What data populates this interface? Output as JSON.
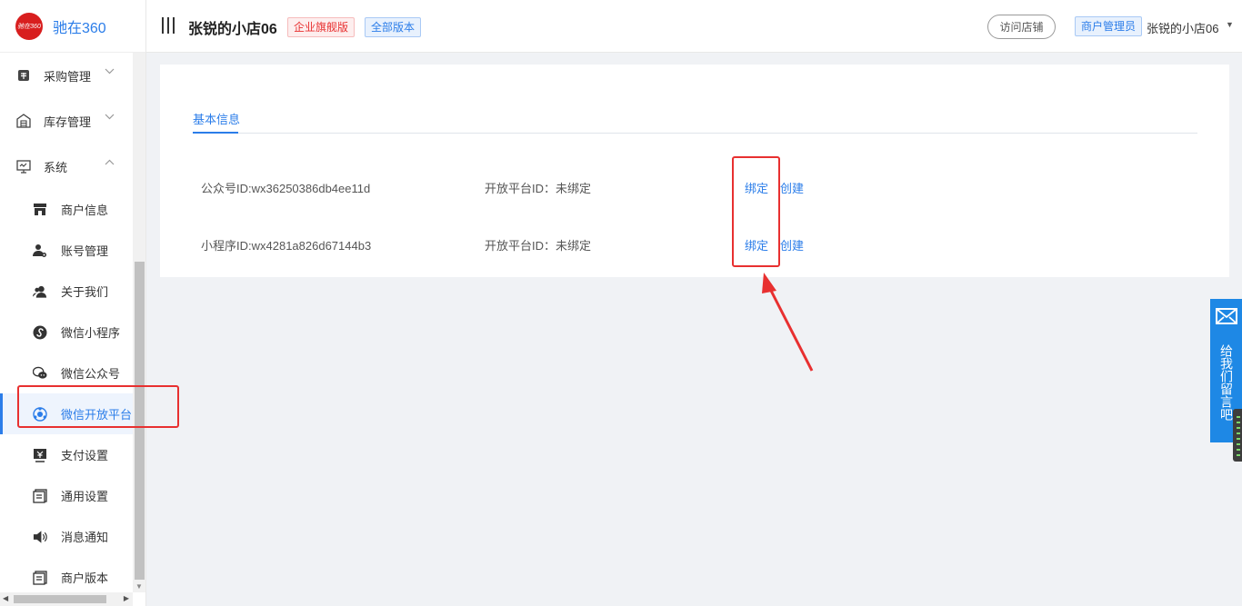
{
  "brand": {
    "name": "驰在360",
    "logo_text": "驰在360"
  },
  "sidebar": {
    "groups": [
      {
        "label": "采购管理",
        "icon": "purchase-icon",
        "expanded": false
      },
      {
        "label": "库存管理",
        "icon": "warehouse-icon",
        "expanded": false
      },
      {
        "label": "系统",
        "icon": "monitor-icon",
        "expanded": true
      }
    ],
    "items": [
      {
        "label": "商户信息",
        "icon": "store-icon"
      },
      {
        "label": "账号管理",
        "icon": "user-gear-icon"
      },
      {
        "label": "关于我们",
        "icon": "users-icon"
      },
      {
        "label": "微信小程序",
        "icon": "miniprogram-icon"
      },
      {
        "label": "微信公众号",
        "icon": "wechat-icon"
      },
      {
        "label": "微信开放平台",
        "icon": "open-platform-icon",
        "active": true
      },
      {
        "label": "支付设置",
        "icon": "payment-icon"
      },
      {
        "label": "通用设置",
        "icon": "settings-doc-icon"
      },
      {
        "label": "消息通知",
        "icon": "speaker-icon"
      },
      {
        "label": "商户版本",
        "icon": "version-doc-icon"
      }
    ]
  },
  "header": {
    "store_name": "张锐的小店06",
    "edition_badge": "企业旗舰版",
    "version_badge": "全部版本",
    "visit_button": "访问店铺",
    "role_badge": "商户管理员",
    "user_name": "张锐的小店06"
  },
  "content": {
    "tab_label": "基本信息",
    "rows": [
      {
        "id_text": "公众号ID:wx36250386db4ee11d",
        "platform_text": "开放平台ID：未绑定",
        "bind_label": "绑定",
        "create_label": "创建"
      },
      {
        "id_text": "小程序ID:wx4281a826d67144b3",
        "platform_text": "开放平台ID：未绑定",
        "bind_label": "绑定",
        "create_label": "创建"
      }
    ]
  },
  "feedback": {
    "label": "给我们留言吧",
    "icon": "envelope-icon"
  },
  "colors": {
    "accent": "#2b7de9",
    "highlight": "#e83030",
    "brand_red": "#d81e1e",
    "feedback_blue": "#1e88e5"
  }
}
